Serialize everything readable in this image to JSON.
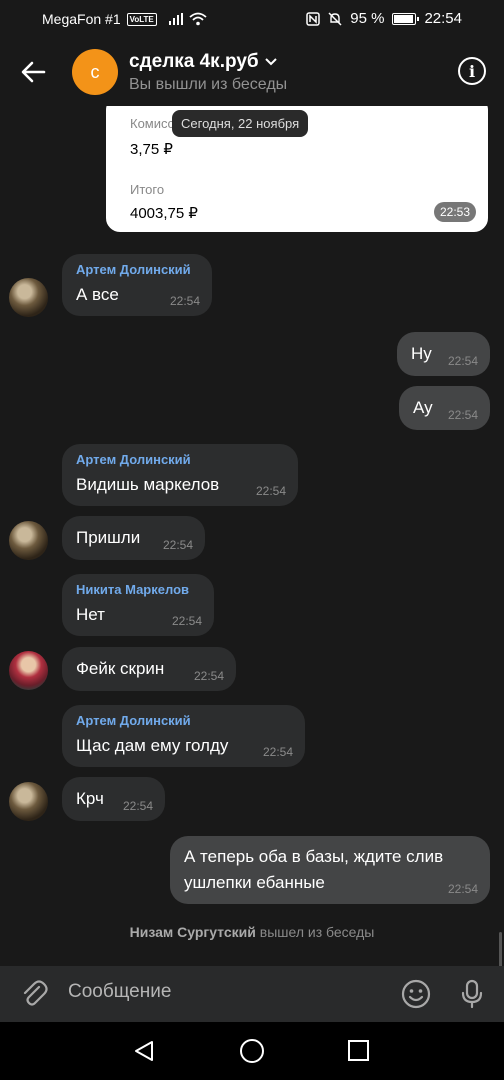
{
  "status_bar": {
    "carrier": "MegaFon #1",
    "volte": "VoLTE",
    "battery": "95 %",
    "battery_level": 0.95,
    "time": "22:54"
  },
  "header": {
    "avatar_letter": "с",
    "title": "сделка 4к.руб",
    "subtitle": "Вы вышли из беседы"
  },
  "receipt": {
    "commission_label": "Комиссия",
    "commission_value": "3,75 ₽",
    "total_label": "Итого",
    "total_value": "4003,75 ₽",
    "time": "22:53"
  },
  "date_pill": "Сегодня, 22 ноября",
  "messages": [
    {
      "author": "Артем Долинский",
      "text": "А все",
      "time": "22:54"
    },
    {
      "text": "Ну",
      "time": "22:54"
    },
    {
      "text": "Ау",
      "time": "22:54"
    },
    {
      "author": "Артем Долинский",
      "text": "Видишь маркелов",
      "time": "22:54"
    },
    {
      "text": "Пришли",
      "time": "22:54"
    },
    {
      "author": "Никита Маркелов",
      "text": "Нет",
      "time": "22:54"
    },
    {
      "text": "Фейк скрин",
      "time": "22:54"
    },
    {
      "author": "Артем Долинский",
      "text": "Щас дам ему голду",
      "time": "22:54"
    },
    {
      "text": "Крч",
      "time": "22:54"
    },
    {
      "text_line1": "А теперь оба в базы, ждите слив",
      "text_line2": "ушлепки ебанные",
      "time": "22:54"
    }
  ],
  "system": {
    "user": "Низам Сургутский",
    "action": "вышел из беседы"
  },
  "composer": {
    "placeholder": "Сообщение"
  },
  "icons": {
    "back": "arrow-left-icon",
    "info": "info-icon",
    "attach": "paperclip-icon",
    "emoji": "smile-icon",
    "mic": "microphone-icon"
  }
}
